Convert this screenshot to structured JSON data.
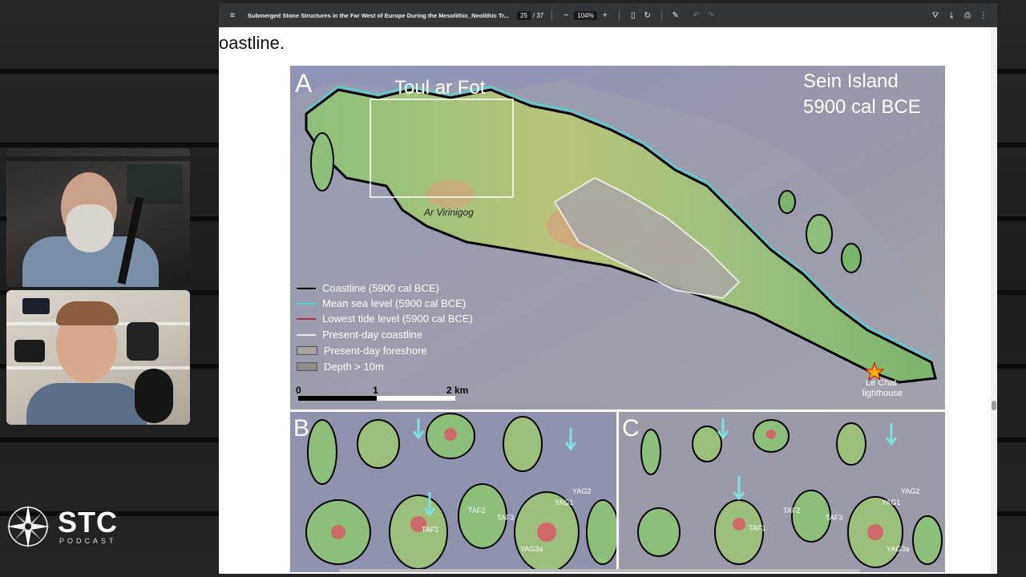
{
  "toolbar": {
    "doc_title": "Submerged Stone Structures in the Far West of Europe During the Mesolithic_Neolithic Tr...",
    "page_current": "25",
    "page_total": "/ 37",
    "zoom": "104%",
    "menu_icon": "menu-icon",
    "zoom_out_label": "−",
    "zoom_in_label": "+"
  },
  "page": {
    "heading_fragment": "oastline."
  },
  "figure": {
    "panel_a": {
      "letter": "A",
      "inset_title": "Toul ar Fot",
      "place_title_line1": "Sein Island",
      "place_title_line2": "5900 cal BCE",
      "area_label": "Ar Virinigog",
      "lighthouse_line1": "Le Chat",
      "lighthouse_line2": "lighthouse",
      "legend": [
        {
          "label": "Coastline (5900 cal BCE)",
          "color": "#000000",
          "kind": "line"
        },
        {
          "label": "Mean sea level (5900 cal BCE)",
          "color": "#4fd6d0",
          "kind": "line"
        },
        {
          "label": "Lowest tide level (5900 cal BCE)",
          "color": "#a8323c",
          "kind": "line"
        },
        {
          "label": "Present-day coastline",
          "color": "#e8e8e8",
          "kind": "line"
        },
        {
          "label": "Present-day foreshore",
          "color": "#a7a39f",
          "kind": "box"
        },
        {
          "label": "Depth > 10m",
          "color": "#8e8c8c",
          "kind": "box"
        }
      ],
      "scale": {
        "t0": "0",
        "t1": "1",
        "t2": "2 km"
      }
    },
    "panel_b": {
      "letter": "B",
      "labels": [
        "TAF2",
        "TAF3",
        "TAF1",
        "YAG1",
        "YAG2",
        "YAG3a"
      ]
    },
    "panel_c": {
      "letter": "C",
      "labels": [
        "TAF2",
        "TAF3",
        "TAF1",
        "YAG1",
        "YAG2",
        "YAG3a"
      ]
    }
  },
  "overlay": {
    "logo_big": "STC",
    "logo_small": "PODCAST"
  },
  "colors": {
    "toolbar_bg": "#323639",
    "sea": "#8a90b2",
    "land_green": "#7fb36a",
    "land_peak": "#d88b6a",
    "coast_line": "#000000",
    "msl_line": "#4fd6d0"
  }
}
